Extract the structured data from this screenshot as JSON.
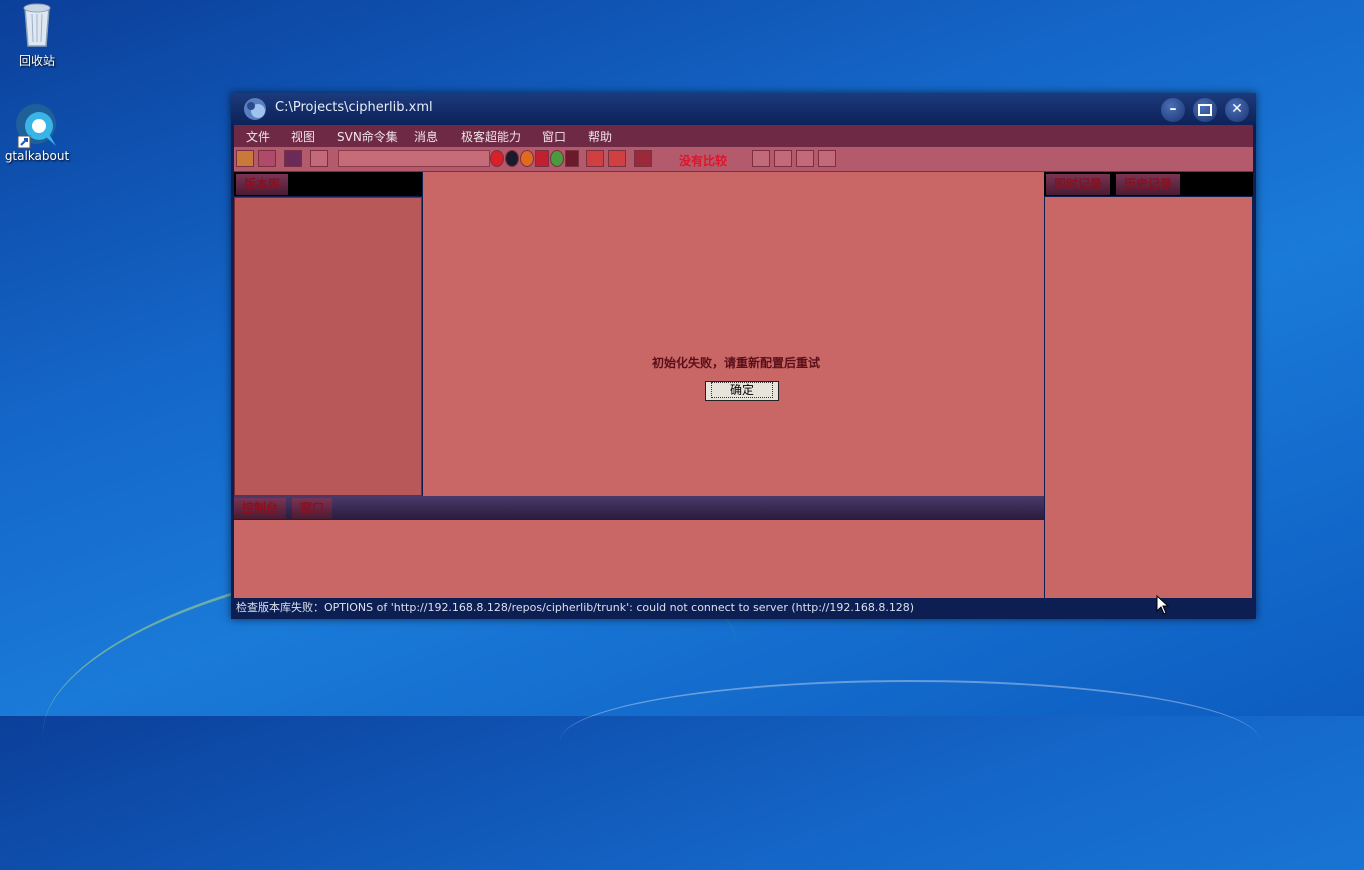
{
  "desktop": {
    "icons": [
      {
        "label": "回收站",
        "icon": "recycle-bin-icon"
      },
      {
        "label": "gtalkabout",
        "icon": "gtalk-icon"
      }
    ]
  },
  "window": {
    "title": "C:\\Projects\\cipherlib.xml",
    "controls": {
      "minimize": "minimize-icon",
      "maximize": "maximize-icon",
      "close": "close-icon"
    }
  },
  "menu": [
    "文件",
    "视图",
    "SVN命令集",
    "消息",
    "极客超能力",
    "窗口",
    "帮助"
  ],
  "toolbar": {
    "compare_status": "没有比较",
    "path_input_value": ""
  },
  "left_panel": {
    "tab": "版本库"
  },
  "right_panel": {
    "tabs": [
      "即时记录",
      "历史记录"
    ]
  },
  "bottom_panel": {
    "tabs": [
      "控制台",
      "窗口"
    ]
  },
  "dialog": {
    "message": "初始化失败，请重新配置后重试",
    "ok_label": "确定"
  },
  "status_bar": {
    "text": "检查版本库失败：OPTIONS of 'http://192.168.8.128/repos/cipherlib/trunk': could not connect to server (http://192.168.8.128)"
  },
  "colors": {
    "desktop_bg": "#1466c8",
    "window_frame": "#0d1f52",
    "menu_bg": "#6e2a44",
    "panel_bg": "#c96666",
    "status_red": "#e0142a"
  }
}
